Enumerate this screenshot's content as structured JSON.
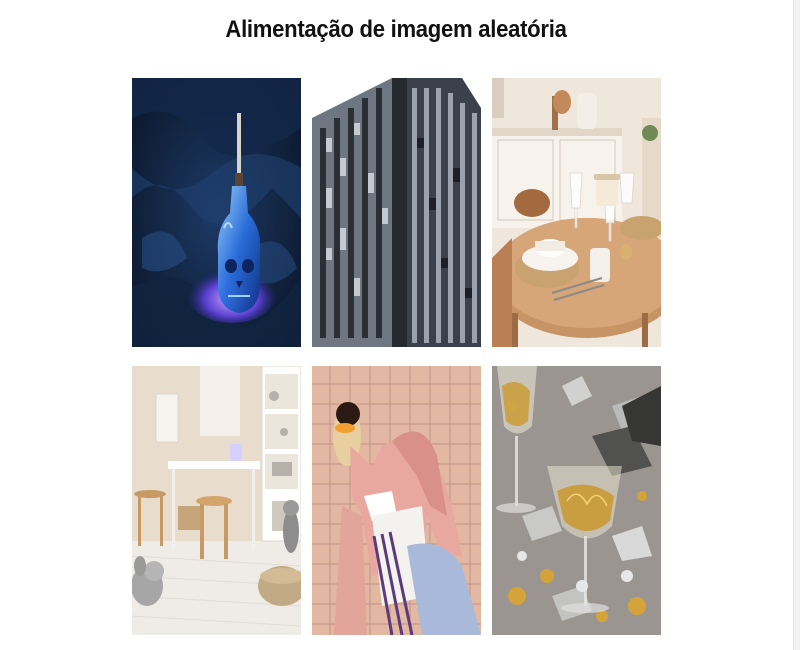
{
  "page": {
    "title": "Alimentação de imagem aleatória"
  },
  "feed": {
    "images": [
      {
        "name": "feed-image-crystal-skull-bottle",
        "subject": "crystal skull bottle on dark blue fabric"
      },
      {
        "name": "feed-image-skyscraper",
        "subject": "tall glass skyscraper facade"
      },
      {
        "name": "feed-image-dining-table",
        "subject": "round wooden dining table with plates and glasses"
      },
      {
        "name": "feed-image-kids-room",
        "subject": "kids room with white desk and wooden stools"
      },
      {
        "name": "feed-image-fashion-portrait",
        "subject": "person in pink coat against tiled wall"
      },
      {
        "name": "feed-image-champagne-confetti",
        "subject": "champagne glasses with gold and silver confetti"
      }
    ]
  },
  "colors": {
    "background": "#ffffff",
    "title": "#111111"
  }
}
